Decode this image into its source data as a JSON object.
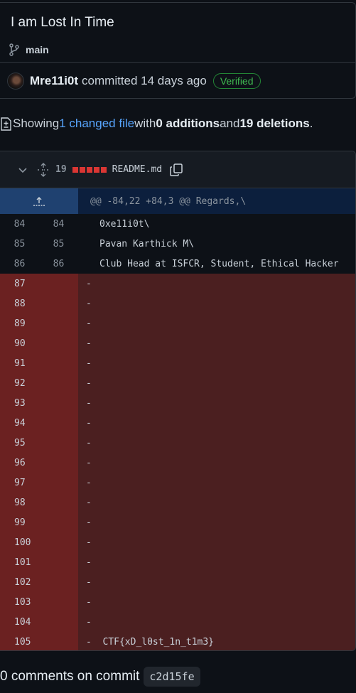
{
  "commit": {
    "title": "I am Lost In Time",
    "branch": "main",
    "author": "Mre11i0t",
    "action": "committed 14 days ago",
    "badge": "Verified"
  },
  "summary": {
    "prefix": "Showing ",
    "changed": "1 changed file",
    "mid": " with ",
    "additions": "0 additions",
    "and": " and ",
    "deletions": "19 deletions",
    "end": "."
  },
  "file": {
    "change_count": "19",
    "name": "README.md",
    "hunk": "@@ -84,22 +84,3 @@ Regards,\\",
    "context_lines": [
      {
        "old": "84",
        "new": "84",
        "text": "0xe11i0t\\"
      },
      {
        "old": "85",
        "new": "85",
        "text": "Pavan Karthick M\\"
      },
      {
        "old": "86",
        "new": "86",
        "text": "Club Head at ISFCR, Student, Ethical Hacker"
      }
    ],
    "deleted_lines": [
      {
        "num": "87",
        "text": "-"
      },
      {
        "num": "88",
        "text": "-"
      },
      {
        "num": "89",
        "text": "-"
      },
      {
        "num": "90",
        "text": "-"
      },
      {
        "num": "91",
        "text": "-"
      },
      {
        "num": "92",
        "text": "-"
      },
      {
        "num": "93",
        "text": "-"
      },
      {
        "num": "94",
        "text": "-"
      },
      {
        "num": "95",
        "text": "-"
      },
      {
        "num": "96",
        "text": "-"
      },
      {
        "num": "97",
        "text": "-"
      },
      {
        "num": "98",
        "text": "-"
      },
      {
        "num": "99",
        "text": "-"
      },
      {
        "num": "100",
        "text": "-"
      },
      {
        "num": "101",
        "text": "-"
      },
      {
        "num": "102",
        "text": "-"
      },
      {
        "num": "103",
        "text": "-"
      },
      {
        "num": "104",
        "text": "-"
      },
      {
        "num": "105",
        "text": "-  CTF{xD_l0st_1n_t1m3}"
      }
    ]
  },
  "footer": {
    "comments": "0 comments on commit",
    "sha": "c2d15fe"
  },
  "colors": {
    "background": "#0d1117",
    "link": "#58a6ff",
    "verified": "#3fb950",
    "deletion_bg": "#4b1f20",
    "deletion_num_bg": "#6b2121"
  }
}
